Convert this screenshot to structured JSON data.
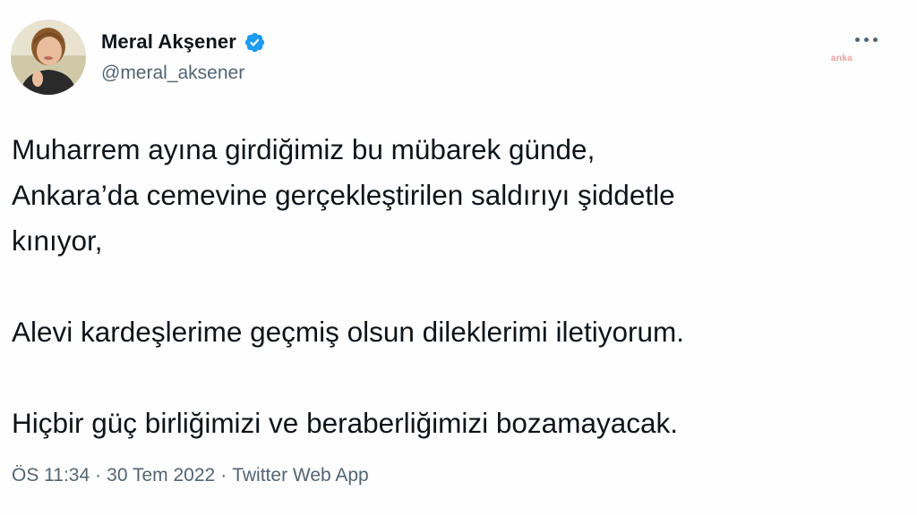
{
  "author": {
    "display_name": "Meral Akşener",
    "handle": "@meral_aksener",
    "verified": true,
    "avatar_icon": "profile-photo"
  },
  "header": {
    "more_icon": "more-horizontal-icon",
    "watermark": "anka"
  },
  "tweet": {
    "lines": [
      "Muharrem ayına girdiğimiz bu mübarek günde,",
      "Ankara’da cemevine gerçekleştirilen saldırıyı şiddetle",
      "kınıyor,",
      "",
      "Alevi kardeşlerime geçmiş olsun dileklerimi iletiyorum.",
      "",
      "Hiçbir güç birliğimizi ve beraberliğimizi bozamayacak."
    ]
  },
  "meta": {
    "time": "ÖS 11:34",
    "sep1": "·",
    "date": "30 Tem 2022",
    "sep2": "·",
    "source": "Twitter Web App"
  },
  "colors": {
    "text": "#0f1419",
    "secondary": "#536471",
    "verified": "#1d9bf0"
  }
}
